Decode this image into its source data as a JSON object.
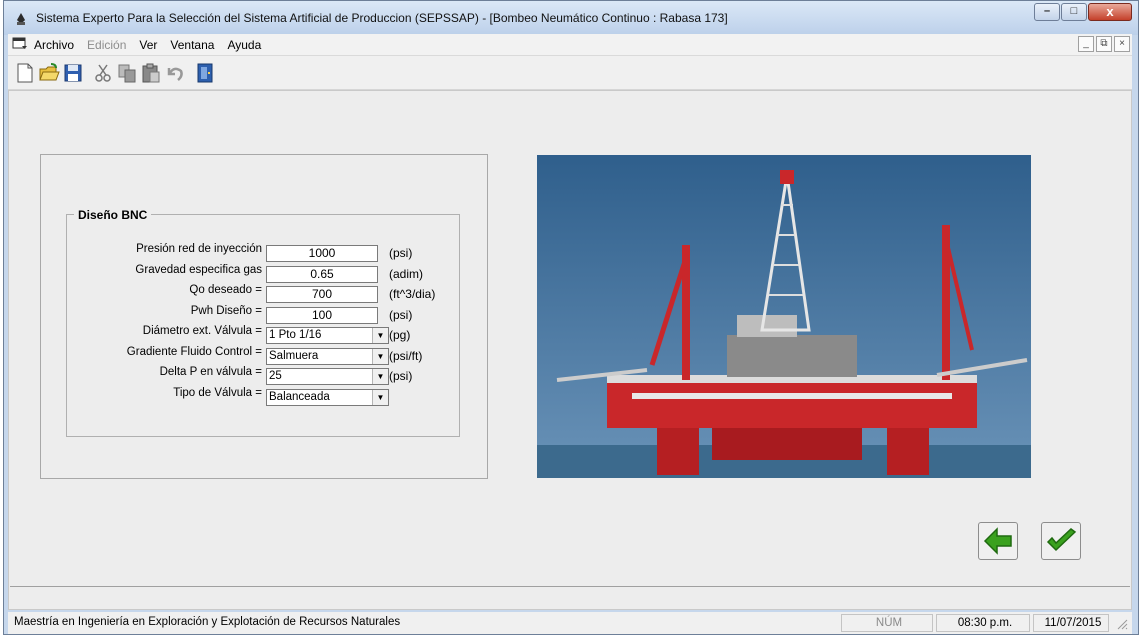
{
  "window": {
    "title": "Sistema Experto Para la Selección del Sistema Artificial de Produccion (SEPSSAP) - [Bombeo Neumático Continuo : Rabasa 173]",
    "minimize_glyph": "–",
    "maximize_glyph": "□",
    "close_glyph": "x"
  },
  "menubar": {
    "items": [
      "Archivo",
      "Edición",
      "Ver",
      "Ventana",
      "Ayuda"
    ],
    "disabled": [
      false,
      true,
      false,
      false,
      false
    ],
    "mdi_minimize": "_",
    "mdi_restore": "⧉",
    "mdi_close": "×"
  },
  "toolbar": {
    "icons": [
      "new-file-icon",
      "open-folder-icon",
      "save-disk-icon",
      "cut-scissors-icon",
      "copy-icon",
      "paste-icon",
      "undo-icon",
      "exit-door-icon"
    ]
  },
  "form": {
    "group_title": "Diseño BNC",
    "rows": [
      {
        "label": "Presión red de inyección",
        "value": "1000",
        "unit": "(psi)",
        "type": "field"
      },
      {
        "label": "Gravedad especifica gas",
        "value": "0.65",
        "unit": "(adim)",
        "type": "field"
      },
      {
        "label": "Qo deseado =",
        "value": "700",
        "unit": "(ft^3/dia)",
        "type": "field"
      },
      {
        "label": "Pwh Diseño =",
        "value": "100",
        "unit": "(psi)",
        "type": "field"
      },
      {
        "label": "Diámetro ext. Válvula =",
        "value": "1 Pto 1/16",
        "unit": "(pg)",
        "type": "combo"
      },
      {
        "label": "Gradiente Fluido Control =",
        "value": "Salmuera",
        "unit": "(psi/ft)",
        "type": "combo"
      },
      {
        "label": "Delta P en válvula =",
        "value": "25",
        "unit": "(psi)",
        "type": "combo"
      },
      {
        "label": "Tipo de Válvula =",
        "value": "Balanceada",
        "unit": "",
        "type": "combo"
      }
    ]
  },
  "buttons": {
    "back_icon": "green-left-arrow-icon",
    "accept_icon": "green-checkmark-icon"
  },
  "statusbar": {
    "message": "Maestría en Ingeniería en Exploración y Explotación de Recursos Naturales",
    "numlock": "NÚM",
    "time": "08:30 p.m.",
    "date": "11/07/2015"
  },
  "colors": {
    "accent_green": "#3aa11e",
    "rig_red": "#c9272a",
    "sky_blue": "#3d6f9a"
  }
}
